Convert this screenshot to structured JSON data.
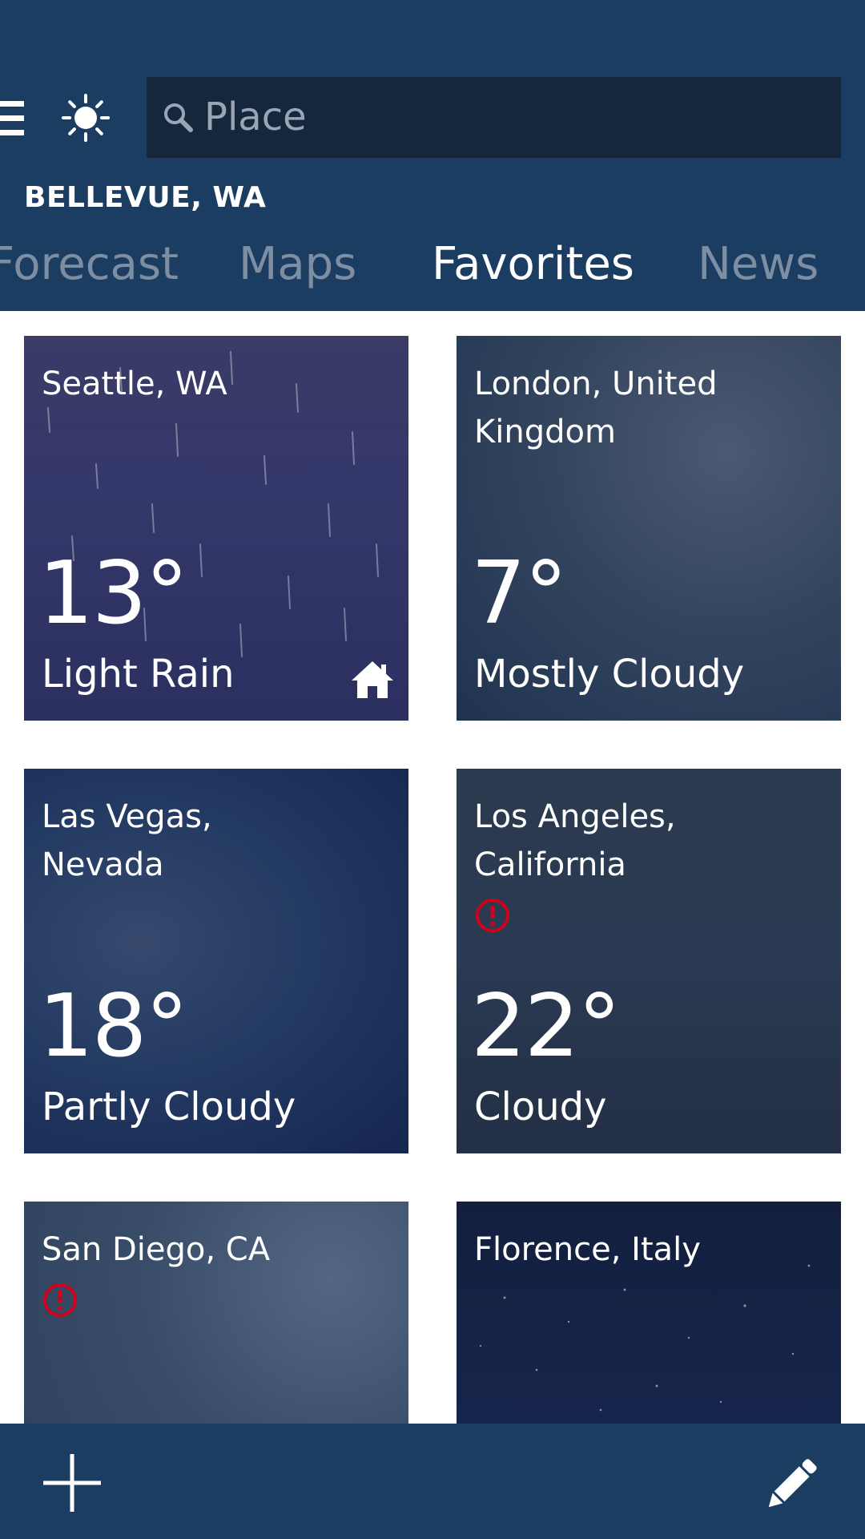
{
  "search": {
    "placeholder": "Place"
  },
  "location": "BELLEVUE, WA",
  "tabs": [
    {
      "label": "Forecast",
      "active": false
    },
    {
      "label": "Maps",
      "active": false
    },
    {
      "label": "Favorites",
      "active": true
    },
    {
      "label": "News",
      "active": false
    }
  ],
  "favorites": [
    {
      "city": "Seattle, WA",
      "temp": "13°",
      "condition": "Light Rain",
      "home": true,
      "alert": false
    },
    {
      "city": "London, United Kingdom",
      "temp": "7°",
      "condition": "Mostly Cloudy",
      "home": false,
      "alert": false
    },
    {
      "city": "Las Vegas, Nevada",
      "temp": "18°",
      "condition": "Partly Cloudy",
      "home": false,
      "alert": false
    },
    {
      "city": "Los Angeles, California",
      "temp": "22°",
      "condition": "Cloudy",
      "home": false,
      "alert": true
    },
    {
      "city": "San Diego, CA",
      "alert": true
    },
    {
      "city": "Florence, Italy",
      "alert": false
    }
  ],
  "colors": {
    "header": "#1c3d62",
    "search_bg": "#14273d",
    "tab_inactive": "#7d8ea3",
    "alert": "#d0021b"
  },
  "icons": {
    "menu": "hamburger-icon",
    "app": "sun-icon",
    "search": "search-icon",
    "home": "home-icon",
    "alert": "alert-icon",
    "add": "plus-icon",
    "edit": "pencil-icon"
  }
}
